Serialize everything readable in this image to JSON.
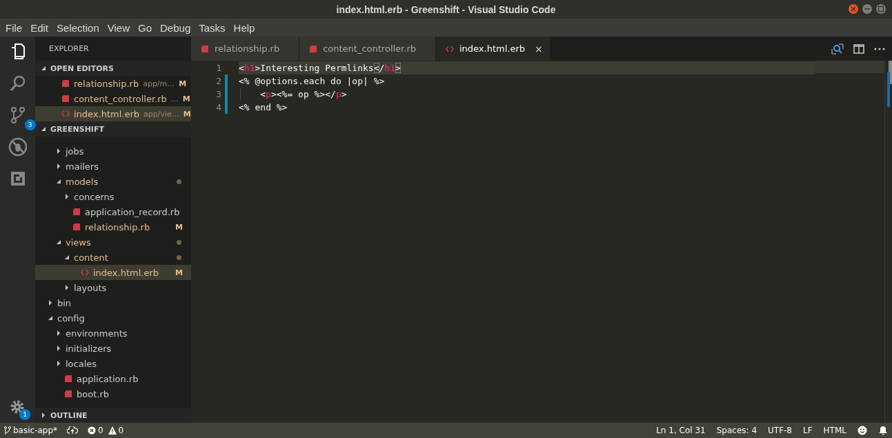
{
  "window": {
    "title": "index.html.erb - Greenshift - Visual Studio Code"
  },
  "menu": [
    "File",
    "Edit",
    "Selection",
    "View",
    "Go",
    "Debug",
    "Tasks",
    "Help"
  ],
  "activity": [
    {
      "kind": "files",
      "selected": true
    },
    {
      "kind": "search",
      "selected": false
    },
    {
      "kind": "git",
      "selected": false,
      "badge": "3"
    },
    {
      "kind": "debug",
      "selected": false
    },
    {
      "kind": "extensions",
      "selected": false
    }
  ],
  "settings_badge": "1",
  "sidebar": {
    "title": "EXPLORER",
    "open_editors": {
      "title": "OPEN EDITORS",
      "expanded": true,
      "items": [
        {
          "name": "relationship.rb",
          "path": "app/m…",
          "kind": "ruby",
          "status": "M",
          "selected": false
        },
        {
          "name": "content_controller.rb",
          "path": "…",
          "kind": "ruby",
          "status": "M",
          "selected": false
        },
        {
          "name": "index.html.erb",
          "path": "app/vie…",
          "kind": "erb",
          "status": "M",
          "selected": true
        }
      ]
    },
    "folder": {
      "title": "GREENSHIFT",
      "expanded": true,
      "tree": [
        {
          "kind": "group",
          "children": [
            {
              "name": "jobs",
              "kind": "folder",
              "expanded": false,
              "modified": false,
              "dot": false,
              "selected": false
            },
            {
              "name": "mailers",
              "kind": "folder",
              "expanded": false,
              "modified": false,
              "dot": false,
              "selected": false
            },
            {
              "name": "models",
              "kind": "folder",
              "expanded": true,
              "modified": true,
              "dot": true,
              "selected": false,
              "children": [
                {
                  "name": "concerns",
                  "kind": "folder",
                  "expanded": false,
                  "modified": false,
                  "dot": false,
                  "selected": false
                },
                {
                  "name": "application_record.rb",
                  "kind": "ruby",
                  "modified": false,
                  "selected": false
                },
                {
                  "name": "relationship.rb",
                  "kind": "ruby",
                  "modified": true,
                  "status": "M",
                  "selected": false
                }
              ]
            },
            {
              "name": "views",
              "kind": "folder",
              "expanded": true,
              "modified": true,
              "dot": true,
              "selected": false,
              "children": [
                {
                  "name": "content",
                  "kind": "folder",
                  "expanded": true,
                  "modified": true,
                  "dot": true,
                  "selected": false,
                  "children": [
                    {
                      "name": "index.html.erb",
                      "kind": "erb",
                      "modified": true,
                      "status": "M",
                      "selected": true
                    }
                  ]
                },
                {
                  "name": "layouts",
                  "kind": "folder",
                  "expanded": false,
                  "modified": false,
                  "dot": false,
                  "selected": false
                }
              ]
            }
          ]
        },
        {
          "name": "bin",
          "kind": "folder",
          "expanded": false,
          "modified": false,
          "dot": false,
          "selected": false
        },
        {
          "name": "config",
          "kind": "folder",
          "expanded": true,
          "modified": false,
          "dot": false,
          "selected": false,
          "children": [
            {
              "name": "environments",
              "kind": "folder",
              "expanded": false,
              "modified": false,
              "dot": false,
              "selected": false
            },
            {
              "name": "initializers",
              "kind": "folder",
              "expanded": false,
              "modified": false,
              "dot": false,
              "selected": false
            },
            {
              "name": "locales",
              "kind": "folder",
              "expanded": false,
              "modified": false,
              "dot": false,
              "selected": false
            },
            {
              "name": "application.rb",
              "kind": "ruby",
              "modified": false,
              "selected": false
            },
            {
              "name": "boot.rb",
              "kind": "ruby",
              "modified": false,
              "selected": false
            }
          ]
        }
      ]
    },
    "outline": {
      "title": "OUTLINE",
      "expanded": false
    }
  },
  "tabs": [
    {
      "name": "relationship.rb",
      "kind": "ruby",
      "selected": false
    },
    {
      "name": "content_controller.rb",
      "kind": "ruby",
      "selected": false
    },
    {
      "name": "index.html.erb",
      "kind": "erb",
      "selected": true,
      "close": "×"
    }
  ],
  "editor": {
    "lines": [
      {
        "number": "1",
        "current": true,
        "changed": false,
        "indent_guide": false,
        "tokens": [
          {
            "text": "<",
            "kind": "punct"
          },
          {
            "text": "h1",
            "kind": "tag"
          },
          {
            "text": ">Interesting Permlinks",
            "kind": "punct"
          },
          {
            "text": "<",
            "kind": "bracket"
          },
          {
            "text": "/",
            "kind": "punct"
          },
          {
            "text": "h1",
            "kind": "tag"
          },
          {
            "text": ">",
            "kind": "bracket"
          }
        ]
      },
      {
        "number": "2",
        "current": false,
        "changed": true,
        "indent_guide": false,
        "tokens": [
          {
            "text": "<% @options.each do |op| %>",
            "kind": "punct"
          }
        ]
      },
      {
        "number": "3",
        "current": false,
        "changed": true,
        "indent_guide": true,
        "tokens": [
          {
            "text": "    <",
            "kind": "punct"
          },
          {
            "text": "p",
            "kind": "tag"
          },
          {
            "text": "><%= op %></",
            "kind": "punct"
          },
          {
            "text": "p",
            "kind": "tag"
          },
          {
            "text": ">",
            "kind": "punct"
          }
        ]
      },
      {
        "number": "4",
        "current": false,
        "changed": true,
        "indent_guide": false,
        "tokens": [
          {
            "text": "<% end %>",
            "kind": "punct"
          }
        ]
      }
    ]
  },
  "status_bar": {
    "branch": "basic-app*",
    "errors": "0",
    "warnings": "0",
    "right": [
      "Ln 1, Col 31",
      "Spaces: 4",
      "UTF-8",
      "LF",
      "HTML"
    ]
  }
}
